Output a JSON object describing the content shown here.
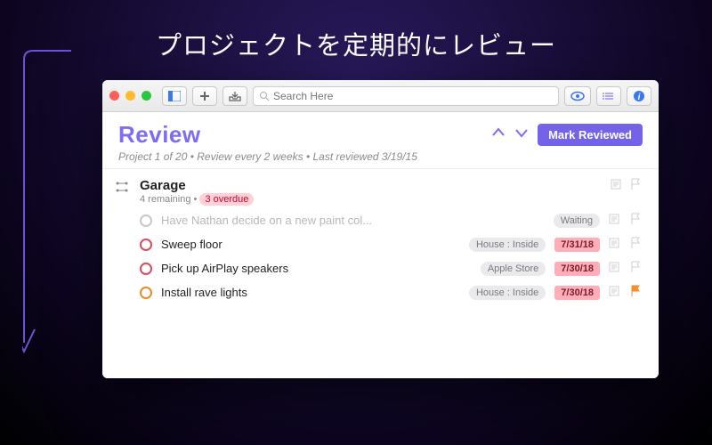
{
  "headline": "プロジェクトを定期的にレビュー",
  "toolbar": {
    "search_placeholder": "Search Here"
  },
  "header": {
    "title": "Review",
    "mark_label": "Mark Reviewed",
    "subtitle": "Project 1 of 20 • Review every 2 weeks • Last reviewed 3/19/15"
  },
  "project": {
    "name": "Garage",
    "remaining": "4 remaining • ",
    "overdue": "3 overdue"
  },
  "tasks": [
    {
      "title": "Have Nathan decide on a new paint col...",
      "tag": "Waiting",
      "due": "",
      "dim": true,
      "circ": "gray",
      "flag": false
    },
    {
      "title": "Sweep floor",
      "tag": "House : Inside",
      "due": "7/31/18",
      "dim": false,
      "circ": "red",
      "flag": false
    },
    {
      "title": "Pick up AirPlay speakers",
      "tag": "Apple Store",
      "due": "7/30/18",
      "dim": false,
      "circ": "red",
      "flag": false
    },
    {
      "title": "Install rave lights",
      "tag": "House : Inside",
      "due": "7/30/18",
      "dim": false,
      "circ": "or",
      "flag": true
    }
  ]
}
